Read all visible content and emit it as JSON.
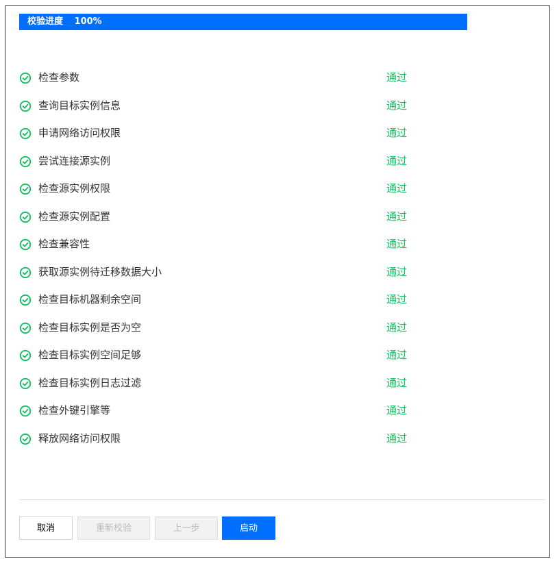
{
  "progress": {
    "label": "校验进度",
    "percent_text": "100%",
    "value": 1.0,
    "color": "#006eff"
  },
  "checks": [
    {
      "label": "检查参数",
      "status": "通过",
      "icon": "check-circle-icon"
    },
    {
      "label": "查询目标实例信息",
      "status": "通过",
      "icon": "check-circle-icon"
    },
    {
      "label": "申请网络访问权限",
      "status": "通过",
      "icon": "check-circle-icon"
    },
    {
      "label": "尝试连接源实例",
      "status": "通过",
      "icon": "check-circle-icon"
    },
    {
      "label": "检查源实例权限",
      "status": "通过",
      "icon": "check-circle-icon"
    },
    {
      "label": "检查源实例配置",
      "status": "通过",
      "icon": "check-circle-icon"
    },
    {
      "label": "检查兼容性",
      "status": "通过",
      "icon": "check-circle-icon"
    },
    {
      "label": "获取源实例待迁移数据大小",
      "status": "通过",
      "icon": "check-circle-icon"
    },
    {
      "label": "检查目标机器剩余空间",
      "status": "通过",
      "icon": "check-circle-icon"
    },
    {
      "label": "检查目标实例是否为空",
      "status": "通过",
      "icon": "check-circle-icon"
    },
    {
      "label": "检查目标实例空间足够",
      "status": "通过",
      "icon": "check-circle-icon"
    },
    {
      "label": "检查目标实例日志过滤",
      "status": "通过",
      "icon": "check-circle-icon"
    },
    {
      "label": "检查外键引擎等",
      "status": "通过",
      "icon": "check-circle-icon"
    },
    {
      "label": "释放网络访问权限",
      "status": "通过",
      "icon": "check-circle-icon"
    }
  ],
  "status_color": "#0abf5b",
  "footer": {
    "cancel_label": "取消",
    "recheck_label": "重新校验",
    "prev_label": "上一步",
    "start_label": "启动"
  }
}
